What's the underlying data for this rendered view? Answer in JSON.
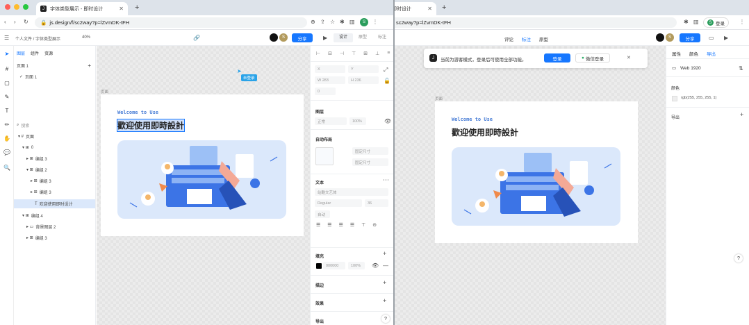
{
  "left": {
    "tab_title": "字体类型展示 - 即时设计",
    "url": "js.design/f/sc2way?p=lZvmDK-tFH",
    "avatar_letter": "S",
    "breadcrumb": "个人文件 / 字体类型展示",
    "zoom": "40%",
    "share_label": "分享",
    "mode_tabs": [
      "设计",
      "原型",
      "标注"
    ],
    "panel_tabs": [
      "图层",
      "组件",
      "资源"
    ],
    "page_section": "页面 1",
    "page_item": "页面 1",
    "layer_search": "搜索",
    "layers": [
      "页面",
      "0",
      "编组 3",
      "编组 2",
      "编组 3",
      "欢迎使用即时设计",
      "编组 4",
      "背景图层 2",
      "编组 3"
    ],
    "frame_label": "页面",
    "cursor_label": "未登录",
    "welcome_text": "Welcome to Use",
    "headline": "歡迎使用即時設計",
    "fields": {
      "x": "X",
      "y": "Y",
      "w": "W",
      "h": "H",
      "w_val": "283",
      "h_val": "236",
      "r": "0"
    },
    "layer_section": "图层",
    "blend": "正常",
    "opacity": "100%",
    "auto_layout": "自动布局",
    "align_option_1": "固定尺寸",
    "align_option_2": "固定尺寸",
    "text_section": "文本",
    "font_family": "站酷文艺体",
    "font_weight": "Regular",
    "font_size": "36",
    "line_height": "自动",
    "fill_section": "填充",
    "fill_hex": "000000",
    "fill_opacity": "100%",
    "stroke_section": "描边",
    "effect_section": "效果",
    "export_section": "导出",
    "help": "?"
  },
  "right": {
    "tab_title": "即时设计",
    "url": "sc2way?p=lZvmDK-tFH",
    "avatar_letter": "S",
    "sync_label": "登录",
    "mode_tabs": [
      "评论",
      "标注",
      "原型"
    ],
    "share_label": "分享",
    "notice_text": "当前为游客模式，登录后可使用全部功能。",
    "login_button": "登录",
    "wechat_button": "微信登录",
    "frame_label": "页面",
    "welcome_text": "Welcome to Use",
    "headline": "歡迎使用即時設計",
    "panel_tabs": [
      "属性",
      "颜色",
      "导出"
    ],
    "device": "Web 1920",
    "color_section": "颜色",
    "color_value": "rgb(255, 255, 255, 1)",
    "export_section": "导出",
    "help": "?"
  },
  "colors": {
    "accent": "#1677ff",
    "illustration_bg": "#dbe8fb",
    "welcome": "#4a7ed6",
    "canvas": "#ececec"
  }
}
